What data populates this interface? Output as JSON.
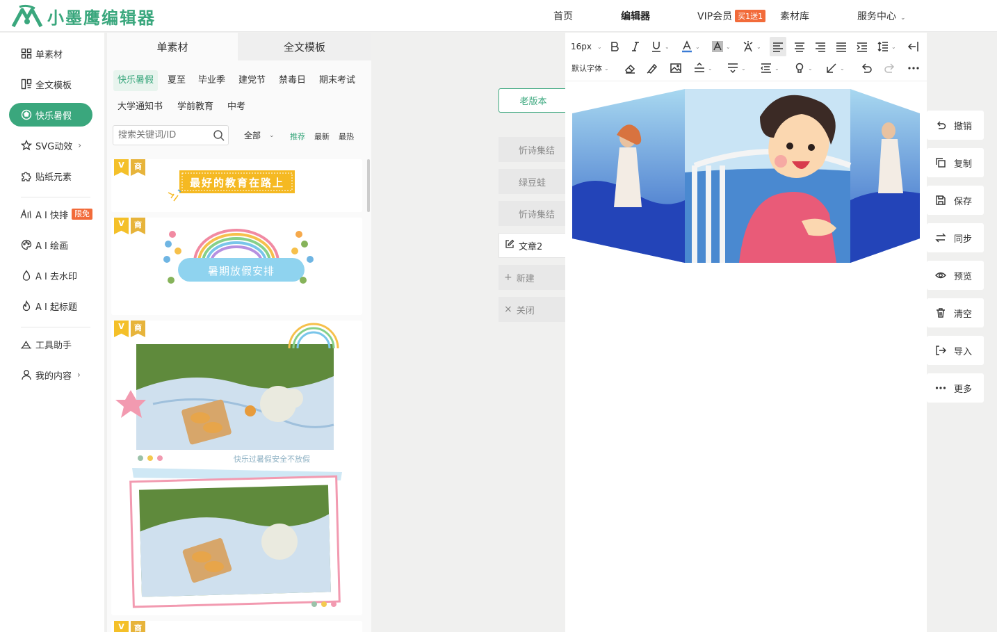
{
  "header": {
    "logo_text": "小墨鹰编辑器",
    "nav": {
      "home": "首页",
      "editor": "编辑器",
      "vip": "VIP会员",
      "vip_badge": "买1送1",
      "library": "素材库",
      "service": "服务中心"
    }
  },
  "sidebar": {
    "items": [
      {
        "label": "单素材",
        "icon": "grid-icon"
      },
      {
        "label": "全文模板",
        "icon": "template-icon"
      },
      {
        "label": "快乐暑假",
        "icon": "ball-icon"
      },
      {
        "label": "SVG动效",
        "icon": "star-icon"
      },
      {
        "label": "贴纸元素",
        "icon": "puzzle-icon"
      },
      {
        "label": "A I 快排",
        "icon": "ai-icon",
        "badge": "限免"
      },
      {
        "label": "A I 绘画",
        "icon": "palette-icon"
      },
      {
        "label": "A I 去水印",
        "icon": "drop-icon"
      },
      {
        "label": "A I 起标题",
        "icon": "fire-icon"
      },
      {
        "label": "工具助手",
        "icon": "tools-icon"
      },
      {
        "label": "我的内容",
        "icon": "user-icon"
      }
    ]
  },
  "material": {
    "tabs": [
      "单素材",
      "全文模板"
    ],
    "categories": [
      "快乐暑假",
      "夏至",
      "毕业季",
      "建党节",
      "禁毒日",
      "期末考试",
      "大学通知书",
      "学前教育",
      "中考"
    ],
    "search_placeholder": "搜索关键词/ID",
    "filter": "全部",
    "sort": [
      "推荐",
      "最新",
      "最热"
    ],
    "badge_v": "V",
    "badge_s": "商",
    "cards": [
      {
        "text": "最好的教育在路上"
      },
      {
        "text": "暑期放假安排"
      },
      {
        "text": "快乐过暑假安全不放假"
      }
    ]
  },
  "versions": {
    "old_version": "老版本",
    "articles": [
      "忻诗集结",
      "绿豆蛙",
      "忻诗集结"
    ],
    "current": "文章2",
    "new": "新建",
    "close": "关闭"
  },
  "toolbar": {
    "font_size": "16px",
    "font_family": "默认字体"
  },
  "rightbar": {
    "items": [
      {
        "label": "撤销",
        "icon": "undo-icon"
      },
      {
        "label": "复制",
        "icon": "copy-icon"
      },
      {
        "label": "保存",
        "icon": "save-icon"
      },
      {
        "label": "同步",
        "icon": "sync-icon"
      },
      {
        "label": "预览",
        "icon": "eye-icon"
      },
      {
        "label": "清空",
        "icon": "trash-icon"
      },
      {
        "label": "导入",
        "icon": "import-icon"
      },
      {
        "label": "更多",
        "icon": "more-icon"
      }
    ]
  },
  "colors": {
    "accent": "#3aa77d",
    "badge_orange": "#f26b3a"
  }
}
